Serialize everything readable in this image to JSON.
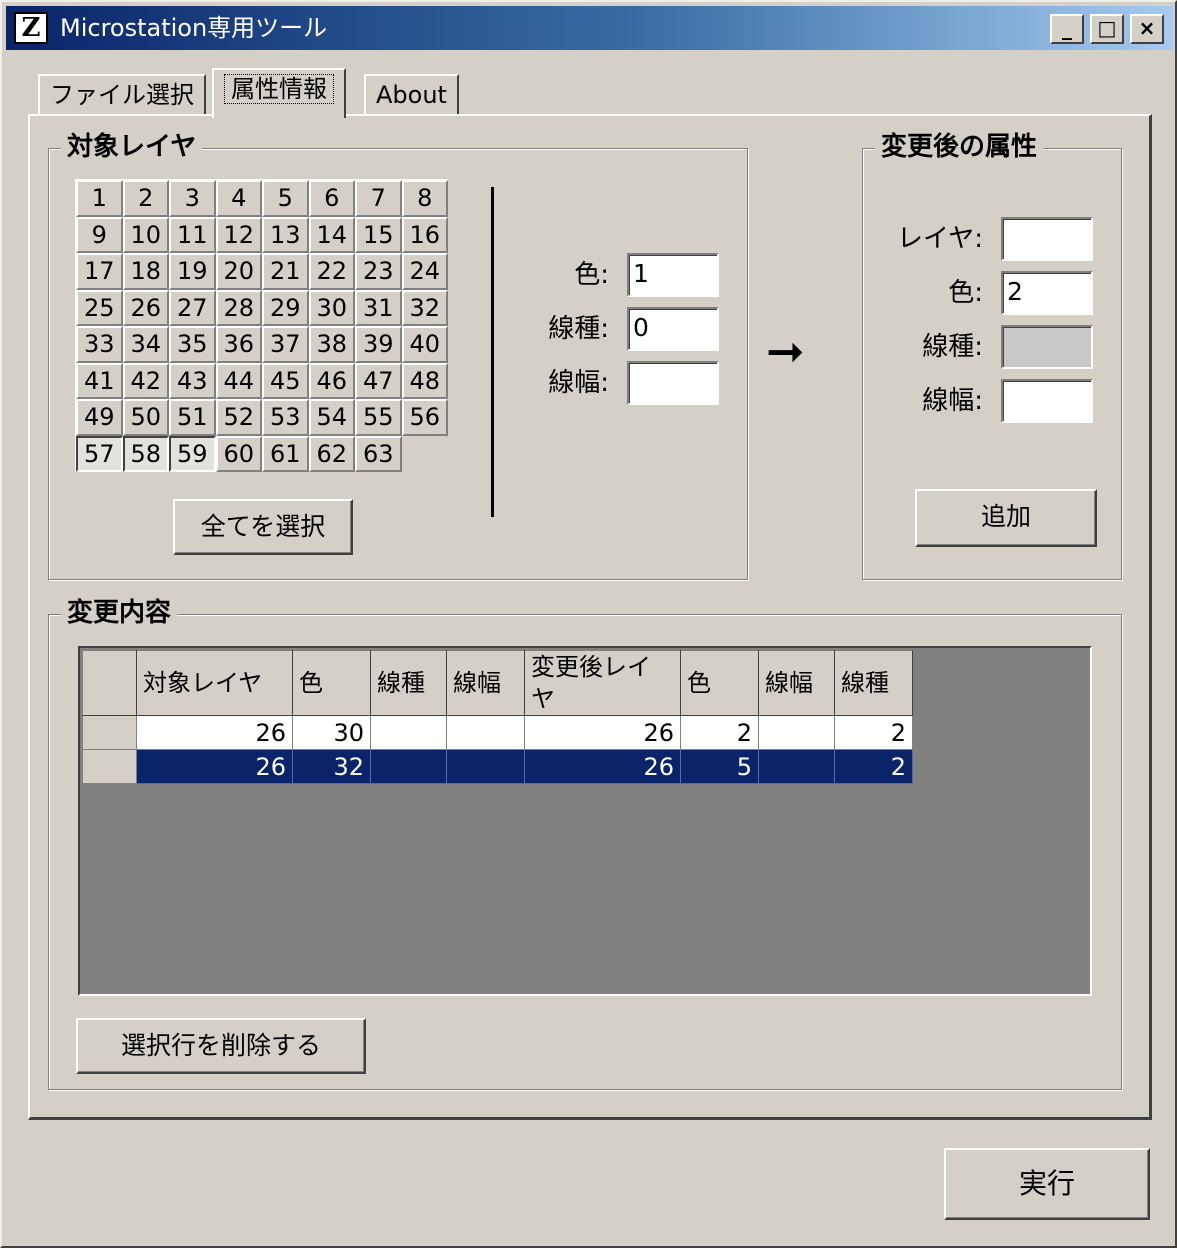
{
  "window": {
    "title": "Microstation専用ツール",
    "icon_glyph": "Z",
    "minimize_glyph": "_",
    "maximize_glyph": "□",
    "close_glyph": "×"
  },
  "tabs": [
    {
      "label": "ファイル選択"
    },
    {
      "label": "属性情報"
    },
    {
      "label": "About"
    }
  ],
  "target_layer": {
    "title": "対象レイヤ",
    "layers": [
      "1",
      "2",
      "3",
      "4",
      "5",
      "6",
      "7",
      "8",
      "9",
      "10",
      "11",
      "12",
      "13",
      "14",
      "15",
      "16",
      "17",
      "18",
      "19",
      "20",
      "21",
      "22",
      "23",
      "24",
      "25",
      "26",
      "27",
      "28",
      "29",
      "30",
      "31",
      "32",
      "33",
      "34",
      "35",
      "36",
      "37",
      "38",
      "39",
      "40",
      "41",
      "42",
      "43",
      "44",
      "45",
      "46",
      "47",
      "48",
      "49",
      "50",
      "51",
      "52",
      "53",
      "54",
      "55",
      "56",
      "57",
      "58",
      "59",
      "60",
      "61",
      "62",
      "63"
    ],
    "pressed_layers": [
      "57",
      "58",
      "59"
    ],
    "select_all_label": "全てを選択",
    "color_label": "色:",
    "color_value": "1",
    "linetype_label": "線種:",
    "linetype_value": "0",
    "linewidth_label": "線幅:",
    "linewidth_value": ""
  },
  "arrow_glyph": "➞",
  "after_attributes": {
    "title": "変更後の属性",
    "layer_label": "レイヤ:",
    "layer_value": "",
    "color_label": "色:",
    "color_value": "2",
    "linetype_label": "線種:",
    "linetype_value": "",
    "linewidth_label": "線幅:",
    "linewidth_value": "",
    "add_label": "追加"
  },
  "changes": {
    "title": "変更内容",
    "columns": [
      "対象レイヤ",
      "色",
      "線種",
      "線幅",
      "変更後レイヤ",
      "色",
      "線幅",
      "線種"
    ],
    "rows": [
      {
        "target_layer": "26",
        "color": "30",
        "linetype": "",
        "linewidth": "",
        "new_layer": "26",
        "new_color": "2",
        "new_linewidth": "",
        "new_linetype": "2"
      },
      {
        "target_layer": "26",
        "color": "32",
        "linetype": "",
        "linewidth": "",
        "new_layer": "26",
        "new_color": "5",
        "new_linewidth": "",
        "new_linetype": "2"
      }
    ],
    "selected_row": 1,
    "delete_label": "選択行を削除する"
  },
  "execute_label": "実行",
  "colors": {
    "face": "#d4d0c8",
    "title_start": "#0a246a",
    "title_end": "#a6caf0",
    "selection": "#0a246a",
    "grid_background": "#808080"
  }
}
